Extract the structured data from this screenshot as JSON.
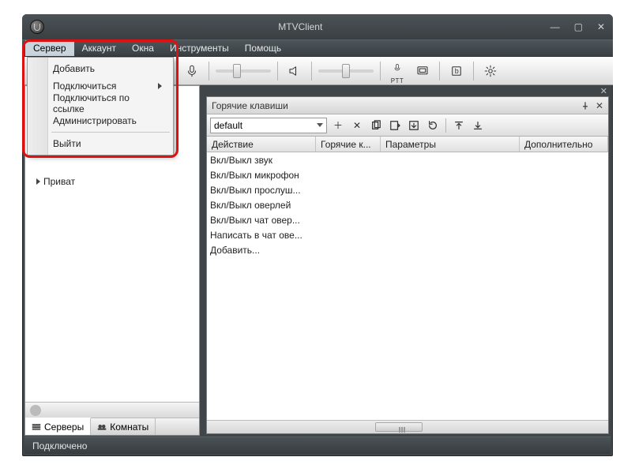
{
  "window": {
    "title": "MTVClient",
    "min_tooltip": "Свернуть",
    "max_tooltip": "Развернуть",
    "close_tooltip": "Закрыть"
  },
  "menubar": {
    "items": [
      {
        "label": "Сервер"
      },
      {
        "label": "Аккаунт"
      },
      {
        "label": "Окна"
      },
      {
        "label": "Инструменты"
      },
      {
        "label": "Помощь"
      }
    ],
    "active_index": 0
  },
  "server_menu": {
    "items": [
      {
        "label": "Добавить"
      },
      {
        "label": "Подключиться",
        "has_submenu": true
      },
      {
        "label": "Подключиться по ссылке"
      },
      {
        "label": "Администрировать"
      }
    ],
    "exit_label": "Выйти"
  },
  "toolbar": {
    "ptt_label": "PTT"
  },
  "left_panel": {
    "privat_label": "Приват",
    "tabs": [
      {
        "label": "Серверы"
      },
      {
        "label": "Комнаты"
      }
    ],
    "active_tab": 0
  },
  "hotkeys_pane": {
    "title": "Горячие клавиши",
    "profile_selected": "default",
    "columns": [
      "Действие",
      "Горячие к...",
      "Параметры",
      "Дополнительно"
    ],
    "rows": [
      "Вкл/Выкл звук",
      "Вкл/Выкл микрофон",
      "Вкл/Выкл прослуш...",
      "Вкл/Выкл оверлей",
      "Вкл/Выкл чат овер...",
      "Написать в чат ове...",
      "Добавить..."
    ]
  },
  "statusbar": {
    "text": "Подключено"
  }
}
